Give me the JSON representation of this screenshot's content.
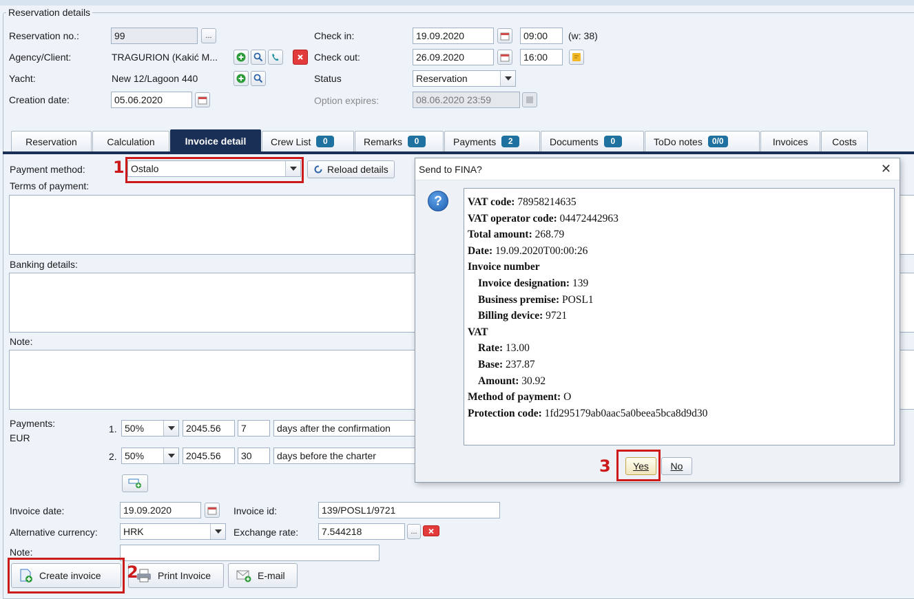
{
  "group_title": "Reservation details",
  "header": {
    "reservation_no_label": "Reservation no.:",
    "reservation_no": "99",
    "more_btn": "...",
    "agency_label": "Agency/Client:",
    "agency": "TRAGURION (Kakić M...",
    "yacht_label": "Yacht:",
    "yacht": "New 12/Lagoon 440",
    "creation_date_label": "Creation date:",
    "creation_date": "05.06.2020",
    "checkin_label": "Check in:",
    "checkin_date": "19.09.2020",
    "checkin_time": "09:00",
    "week": "(w: 38)",
    "checkout_label": "Check out:",
    "checkout_date": "26.09.2020",
    "checkout_time": "16:00",
    "status_label": "Status",
    "status": "Reservation",
    "option_label": "Option expires:",
    "option_value": "08.06.2020 23:59"
  },
  "tabs": [
    {
      "label": "Reservation"
    },
    {
      "label": "Calculation"
    },
    {
      "label": "Invoice detail"
    },
    {
      "label": "Crew List",
      "badge": "0"
    },
    {
      "label": "Remarks",
      "badge": "0"
    },
    {
      "label": "Payments",
      "badge": "2"
    },
    {
      "label": "Documents",
      "badge": "0"
    },
    {
      "label": "ToDo notes",
      "badge": "0/0"
    },
    {
      "label": "Invoices"
    },
    {
      "label": "Costs"
    }
  ],
  "invoice": {
    "payment_method_label": "Payment method:",
    "payment_method": "Ostalo",
    "reload_label": "Reload details",
    "terms_label": "Terms of payment:",
    "banking_label": "Banking details:",
    "note_label": "Note:",
    "payments_label": "Payments:",
    "currency": "EUR",
    "payment_rows": [
      {
        "index": "1.",
        "percent": "50%",
        "amount": "2045.56",
        "days": "7",
        "terms": "days after the confirmation"
      },
      {
        "index": "2.",
        "percent": "50%",
        "amount": "2045.56",
        "days": "30",
        "terms": "days before the charter"
      }
    ],
    "invoice_date_label": "Invoice date:",
    "invoice_date": "19.09.2020",
    "invoice_id_label": "Invoice id:",
    "invoice_id": "139/POSL1/9721",
    "alt_currency_label": "Alternative currency:",
    "alt_currency": "HRK",
    "exchange_rate_label": "Exchange rate:",
    "exchange_rate": "7.544218",
    "note2_label": "Note:",
    "create_invoice": "Create invoice",
    "print_invoice": "Print Invoice",
    "email": "E-mail"
  },
  "dialog": {
    "title": "Send to FINA?",
    "lines": [
      {
        "key": "VAT code:",
        "value": "78958214635",
        "indent": false
      },
      {
        "key": "VAT operator code:",
        "value": "04472442963",
        "indent": false
      },
      {
        "key": "Total amount:",
        "value": "268.79",
        "indent": false
      },
      {
        "key": "Date:",
        "value": "19.09.2020T00:00:26",
        "indent": false
      },
      {
        "key": "Invoice number",
        "value": "",
        "indent": false
      },
      {
        "key": "Invoice designation:",
        "value": "139",
        "indent": true
      },
      {
        "key": "Business premise:",
        "value": "POSL1",
        "indent": true
      },
      {
        "key": "Billing device:",
        "value": "9721",
        "indent": true
      },
      {
        "key": "VAT",
        "value": "",
        "indent": false
      },
      {
        "key": "Rate:",
        "value": "13.00",
        "indent": true
      },
      {
        "key": "Base:",
        "value": "237.87",
        "indent": true
      },
      {
        "key": "Amount:",
        "value": "30.92",
        "indent": true
      },
      {
        "key": "Method of payment:",
        "value": "O",
        "indent": false
      },
      {
        "key": "Protection code:",
        "value": "1fd295179ab0aac5a0beea5bca8d9d30",
        "indent": false
      }
    ],
    "yes": "Yes",
    "no": "No"
  },
  "annotations": {
    "step1": "1",
    "step2": "2",
    "step3": "3"
  },
  "colors": {
    "accent": "#1a2f55",
    "badge": "#1f72a0",
    "highlight": "#cc1a1a"
  }
}
